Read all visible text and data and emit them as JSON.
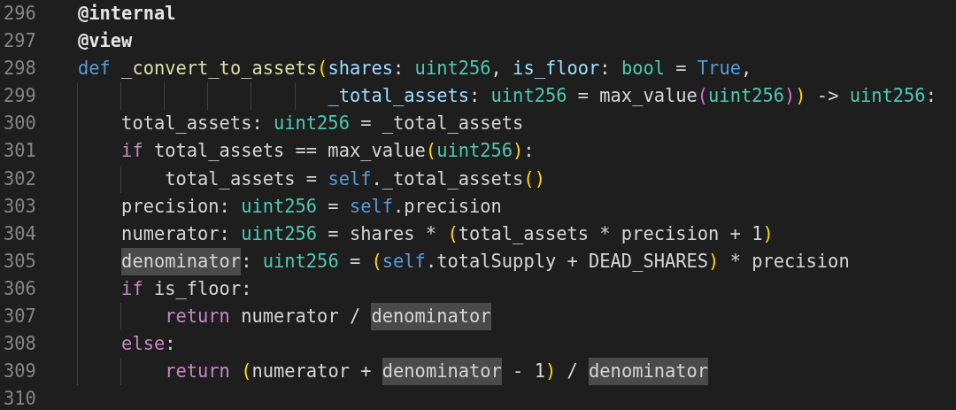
{
  "editor": {
    "lines": [
      {
        "number": "296",
        "tokens": [
          {
            "text": "@internal",
            "kind": "decorator"
          }
        ]
      },
      {
        "number": "297",
        "tokens": [
          {
            "text": "@view",
            "kind": "decorator"
          }
        ]
      },
      {
        "number": "298",
        "tokens": [
          {
            "text": "def",
            "kind": "keyword"
          },
          {
            "text": " _convert_to_assets",
            "kind": "function"
          },
          {
            "text": "(",
            "kind": "bracket"
          },
          {
            "text": "shares",
            "kind": "param"
          },
          {
            "text": ": ",
            "kind": "plain"
          },
          {
            "text": "uint256",
            "kind": "type"
          },
          {
            "text": ", ",
            "kind": "plain"
          },
          {
            "text": "is_floor",
            "kind": "param"
          },
          {
            "text": ": ",
            "kind": "plain"
          },
          {
            "text": "bool",
            "kind": "type"
          },
          {
            "text": " = ",
            "kind": "plain"
          },
          {
            "text": "True",
            "kind": "keyword"
          },
          {
            "text": ",",
            "kind": "plain"
          }
        ]
      },
      {
        "number": "299",
        "tokens": [
          {
            "text": "                       _total_assets",
            "kind": "param"
          },
          {
            "text": ": ",
            "kind": "plain"
          },
          {
            "text": "uint256",
            "kind": "type"
          },
          {
            "text": " = max_value",
            "kind": "plain"
          },
          {
            "text": "(",
            "kind": "bracket2"
          },
          {
            "text": "uint256",
            "kind": "type"
          },
          {
            "text": ")",
            "kind": "bracket2"
          },
          {
            "text": ")",
            "kind": "bracket"
          },
          {
            "text": " -> ",
            "kind": "plain"
          },
          {
            "text": "uint256",
            "kind": "type"
          },
          {
            "text": ":",
            "kind": "plain"
          }
        ]
      },
      {
        "number": "300",
        "tokens": [
          {
            "text": "    total_assets: ",
            "kind": "plain"
          },
          {
            "text": "uint256",
            "kind": "type"
          },
          {
            "text": " = _total_assets",
            "kind": "plain"
          }
        ]
      },
      {
        "number": "301",
        "tokens": [
          {
            "text": "    if",
            "kind": "control"
          },
          {
            "text": " total_assets == max_value",
            "kind": "plain"
          },
          {
            "text": "(",
            "kind": "bracket"
          },
          {
            "text": "uint256",
            "kind": "type"
          },
          {
            "text": ")",
            "kind": "bracket"
          },
          {
            "text": ":",
            "kind": "plain"
          }
        ]
      },
      {
        "number": "302",
        "tokens": [
          {
            "text": "        total_assets = ",
            "kind": "plain"
          },
          {
            "text": "self",
            "kind": "keyword"
          },
          {
            "text": "._total_assets",
            "kind": "plain"
          },
          {
            "text": "()",
            "kind": "bracket"
          }
        ]
      },
      {
        "number": "303",
        "tokens": [
          {
            "text": "    precision: ",
            "kind": "plain"
          },
          {
            "text": "uint256",
            "kind": "type"
          },
          {
            "text": " = ",
            "kind": "plain"
          },
          {
            "text": "self",
            "kind": "keyword"
          },
          {
            "text": ".precision",
            "kind": "plain"
          }
        ]
      },
      {
        "number": "304",
        "tokens": [
          {
            "text": "    numerator: ",
            "kind": "plain"
          },
          {
            "text": "uint256",
            "kind": "type"
          },
          {
            "text": " = shares * ",
            "kind": "plain"
          },
          {
            "text": "(",
            "kind": "bracket"
          },
          {
            "text": "total_assets * precision + 1",
            "kind": "plain"
          },
          {
            "text": ")",
            "kind": "bracket"
          }
        ]
      },
      {
        "number": "305",
        "tokens": [
          {
            "text": "    denominator",
            "kind": "plain",
            "highlight": true
          },
          {
            "text": ": ",
            "kind": "plain"
          },
          {
            "text": "uint256",
            "kind": "type"
          },
          {
            "text": " = ",
            "kind": "plain"
          },
          {
            "text": "(",
            "kind": "bracket"
          },
          {
            "text": "self",
            "kind": "keyword"
          },
          {
            "text": ".totalSupply + DEAD_SHARES",
            "kind": "plain"
          },
          {
            "text": ")",
            "kind": "bracket"
          },
          {
            "text": " * precision",
            "kind": "plain"
          }
        ]
      },
      {
        "number": "306",
        "tokens": [
          {
            "text": "    if",
            "kind": "control"
          },
          {
            "text": " is_floor:",
            "kind": "plain"
          }
        ]
      },
      {
        "number": "307",
        "tokens": [
          {
            "text": "        return",
            "kind": "control"
          },
          {
            "text": " numerator / ",
            "kind": "plain"
          },
          {
            "text": "denominator",
            "kind": "plain",
            "highlight": true
          }
        ]
      },
      {
        "number": "308",
        "tokens": [
          {
            "text": "    else",
            "kind": "control"
          },
          {
            "text": ":",
            "kind": "plain"
          }
        ]
      },
      {
        "number": "309",
        "tokens": [
          {
            "text": "        return",
            "kind": "control"
          },
          {
            "text": " (",
            "kind": "bracket"
          },
          {
            "text": "numerator + ",
            "kind": "plain"
          },
          {
            "text": "denominator",
            "kind": "plain",
            "highlight": true
          },
          {
            "text": " - 1",
            "kind": "plain"
          },
          {
            "text": ")",
            "kind": "bracket"
          },
          {
            "text": " / ",
            "kind": "plain"
          },
          {
            "text": "denominator",
            "kind": "plain",
            "highlight": true
          }
        ]
      },
      {
        "number": "310"
      }
    ]
  }
}
